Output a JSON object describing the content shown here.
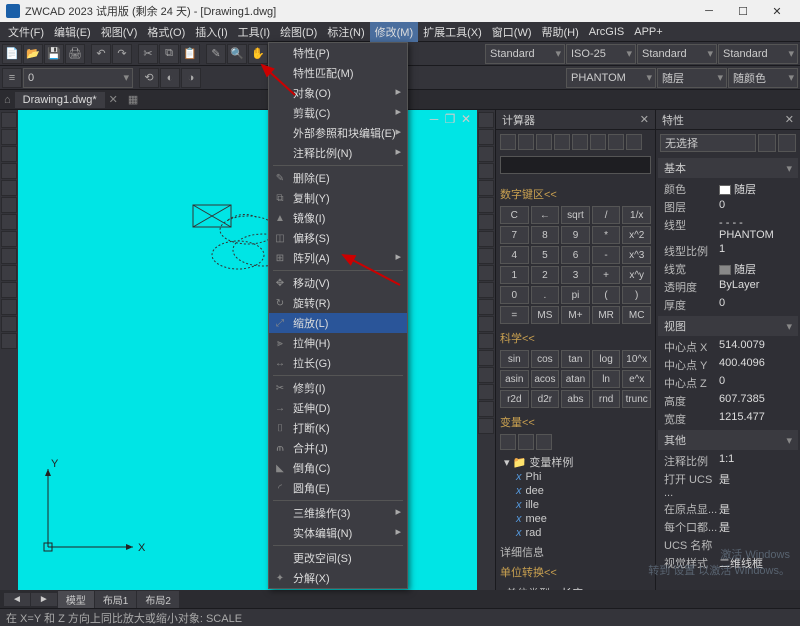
{
  "title": "ZWCAD 2023 试用版 (剩余 24 天) - [Drawing1.dwg]",
  "menus": [
    "文件(F)",
    "编辑(E)",
    "视图(V)",
    "格式(O)",
    "插入(I)",
    "工具(I)",
    "绘图(D)",
    "标注(N)",
    "修改(M)",
    "扩展工具(X)",
    "窗口(W)",
    "帮助(H)",
    "ArcGIS",
    "APP+"
  ],
  "activeMenuIndex": 8,
  "docTab": "Drawing1.dwg*",
  "toolbar2": {
    "combo1": "Standard",
    "combo2": "ISO-25",
    "combo3": "Standard",
    "combo4": "Standard",
    "combo5": "PHANTOM",
    "combo6": "随层",
    "combo7": "随颜色"
  },
  "dropdown": [
    {
      "label": "特性(P)",
      "sep": false,
      "icon": "",
      "sub": false
    },
    {
      "label": "特性匹配(M)",
      "sep": false,
      "icon": "",
      "sub": false
    },
    {
      "label": "对象(O)",
      "sep": false,
      "icon": "",
      "sub": true
    },
    {
      "label": "剪载(C)",
      "sep": false,
      "icon": "",
      "sub": true
    },
    {
      "label": "外部参照和块编辑(E)",
      "sep": false,
      "icon": "",
      "sub": true
    },
    {
      "label": "注释比例(N)",
      "sep": true,
      "icon": "",
      "sub": true
    },
    {
      "label": "删除(E)",
      "sep": false,
      "icon": "✎",
      "sub": false
    },
    {
      "label": "复制(Y)",
      "sep": false,
      "icon": "⧉",
      "sub": false
    },
    {
      "label": "镜像(I)",
      "sep": false,
      "icon": "▲",
      "sub": false
    },
    {
      "label": "偏移(S)",
      "sep": false,
      "icon": "◫",
      "sub": false
    },
    {
      "label": "阵列(A)",
      "sep": true,
      "icon": "⊞",
      "sub": true
    },
    {
      "label": "移动(V)",
      "sep": false,
      "icon": "✥",
      "sub": false
    },
    {
      "label": "旋转(R)",
      "sep": false,
      "icon": "↻",
      "sub": false
    },
    {
      "label": "缩放(L)",
      "sep": false,
      "icon": "⤢",
      "sub": false,
      "hl": true
    },
    {
      "label": "拉伸(H)",
      "sep": false,
      "icon": "⫸",
      "sub": false
    },
    {
      "label": "拉长(G)",
      "sep": true,
      "icon": "↔",
      "sub": false
    },
    {
      "label": "修剪(I)",
      "sep": false,
      "icon": "✂",
      "sub": false
    },
    {
      "label": "延伸(D)",
      "sep": false,
      "icon": "→",
      "sub": false
    },
    {
      "label": "打断(K)",
      "sep": false,
      "icon": "⌷",
      "sub": false
    },
    {
      "label": "合并(J)",
      "sep": false,
      "icon": "⫙",
      "sub": false
    },
    {
      "label": "倒角(C)",
      "sep": false,
      "icon": "◣",
      "sub": false
    },
    {
      "label": "圆角(E)",
      "sep": true,
      "icon": "◜",
      "sub": false
    },
    {
      "label": "三维操作(3)",
      "sep": false,
      "icon": "",
      "sub": true
    },
    {
      "label": "实体编辑(N)",
      "sep": true,
      "icon": "",
      "sub": true
    },
    {
      "label": "更改空间(S)",
      "sep": false,
      "icon": "",
      "sub": false
    },
    {
      "label": "分解(X)",
      "sep": false,
      "icon": "✦",
      "sub": false
    }
  ],
  "calc": {
    "title": "计算器",
    "numSection": "数字键区<<",
    "numBtns": [
      "C",
      "←",
      "sqrt",
      "/",
      "1/x",
      "7",
      "8",
      "9",
      "*",
      "x^2",
      "4",
      "5",
      "6",
      "-",
      "x^3",
      "1",
      "2",
      "3",
      "+",
      "x^y",
      "0",
      ".",
      "pi",
      "(",
      ")",
      "=",
      "MS",
      "M+",
      "MR",
      "MC"
    ],
    "sciSection": "科学<<",
    "sciBtns": [
      "sin",
      "cos",
      "tan",
      "log",
      "10^x",
      "asin",
      "acos",
      "atan",
      "ln",
      "e^x",
      "r2d",
      "d2r",
      "abs",
      "rnd",
      "trunc"
    ],
    "varSection": "变量<<",
    "varRoot": "变量样例",
    "vars": [
      "Phi",
      "dee",
      "ille",
      "mee",
      "rad"
    ],
    "detailSection": "详细信息",
    "unitSection": "单位转换<<",
    "unitType": "单位类型",
    "unitLen": "长度"
  },
  "props": {
    "title": "特性",
    "noSelect": "无选择",
    "catBasic": "基本",
    "rows1": [
      {
        "k": "颜色",
        "v": "随层",
        "sw": "#fff"
      },
      {
        "k": "图层",
        "v": "0"
      },
      {
        "k": "线型",
        "v": "- - - - PHANTOM"
      },
      {
        "k": "线型比例",
        "v": "1"
      },
      {
        "k": "线宽",
        "v": "随层",
        "sw": "#888"
      },
      {
        "k": "透明度",
        "v": "ByLayer"
      },
      {
        "k": "厚度",
        "v": "0"
      }
    ],
    "catView": "视图",
    "rows2": [
      {
        "k": "中心点 X",
        "v": "514.0079"
      },
      {
        "k": "中心点 Y",
        "v": "400.4096"
      },
      {
        "k": "中心点 Z",
        "v": "0"
      },
      {
        "k": "高度",
        "v": "607.7385"
      },
      {
        "k": "宽度",
        "v": "1215.477"
      }
    ],
    "catOther": "其他",
    "rows3": [
      {
        "k": "注释比例",
        "v": "1:1"
      },
      {
        "k": "打开 UCS ...",
        "v": "是"
      },
      {
        "k": "在原点显...",
        "v": "是"
      },
      {
        "k": "每个口都...",
        "v": "是"
      },
      {
        "k": "UCS 名称",
        "v": ""
      },
      {
        "k": "视觉样式",
        "v": "二维线框"
      }
    ]
  },
  "modelTabs": [
    "模型",
    "布局1",
    "布局2"
  ],
  "status": "在 X=Y 和 Z 方向上同比放大或缩小对象: SCALE",
  "axis": {
    "x": "X",
    "y": "Y"
  },
  "watermark": {
    "l1": "激活 Windows",
    "l2": "转到 设置 以激活 Windows。"
  },
  "layoutNav": [
    "◄",
    "►",
    "▼"
  ]
}
